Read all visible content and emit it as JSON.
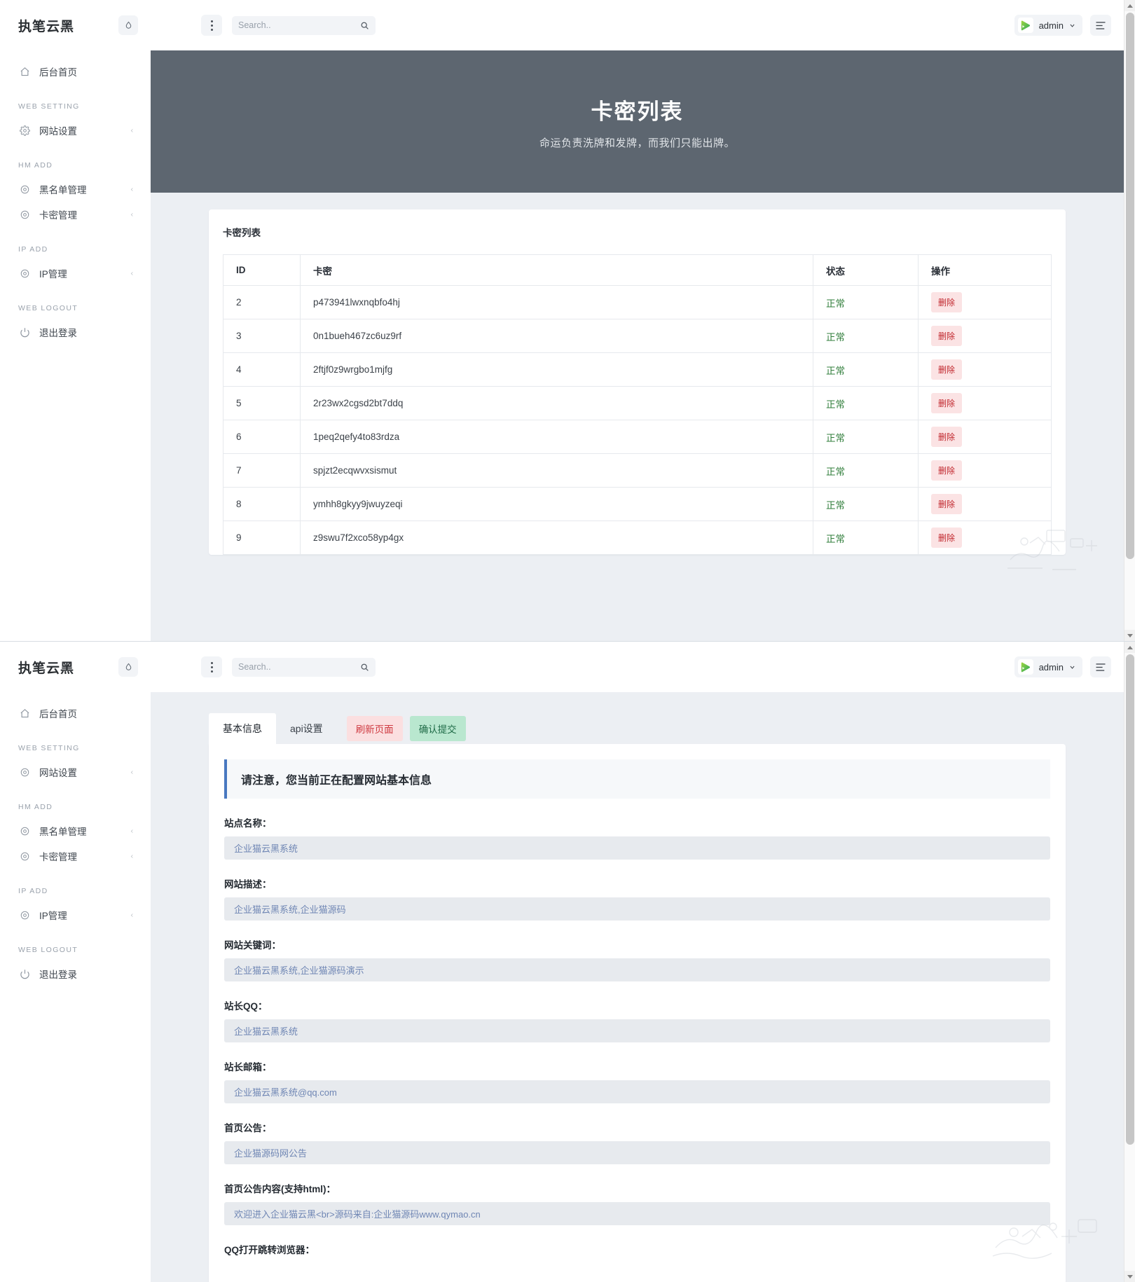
{
  "brand": {
    "name": "执笔云黑",
    "badge_icon": "droplet-icon"
  },
  "topbar": {
    "kebab_icon": "more-vertical-icon",
    "search": {
      "placeholder": "Search..",
      "value": "",
      "icon": "search-icon"
    },
    "user": {
      "name": "admin",
      "avatar_icon": "play-avatar-icon",
      "chevron_icon": "chevron-down-icon"
    },
    "menu_icon": "list-menu-icon"
  },
  "sidebar": {
    "items": [
      {
        "label": "后台首页",
        "icon": "home-icon",
        "caret": false,
        "group": null
      },
      {
        "label": "WEB SETTING",
        "type": "group"
      },
      {
        "label": "网站设置",
        "icon": "gear-icon",
        "caret": true
      },
      {
        "label": "HM ADD",
        "type": "group"
      },
      {
        "label": "黑名单管理",
        "icon": "gear-icon",
        "caret": true
      },
      {
        "label": "卡密管理",
        "icon": "gear-icon",
        "caret": true
      },
      {
        "label": "IP ADD",
        "type": "group"
      },
      {
        "label": "IP管理",
        "icon": "gear-icon",
        "caret": true
      },
      {
        "label": "WEB LOGOUT",
        "type": "group"
      },
      {
        "label": "退出登录",
        "icon": "power-icon",
        "caret": false
      }
    ]
  },
  "view_top": {
    "hero": {
      "title": "卡密列表",
      "subtitle": "命运负责洗牌和发牌，而我们只能出牌。"
    },
    "card": {
      "title": "卡密列表",
      "columns": [
        "ID",
        "卡密",
        "状态",
        "操作"
      ],
      "rows": [
        {
          "id": "2",
          "code": "p473941lwxnqbfo4hj",
          "status": "正常",
          "action": "删除"
        },
        {
          "id": "3",
          "code": "0n1bueh467zc6uz9rf",
          "status": "正常",
          "action": "删除"
        },
        {
          "id": "4",
          "code": "2ftjf0z9wrgbo1mjfg",
          "status": "正常",
          "action": "删除"
        },
        {
          "id": "5",
          "code": "2r23wx2cgsd2bt7ddq",
          "status": "正常",
          "action": "删除"
        },
        {
          "id": "6",
          "code": "1peq2qefy4to83rdza",
          "status": "正常",
          "action": "删除"
        },
        {
          "id": "7",
          "code": "spjzt2ecqwvxsismut",
          "status": "正常",
          "action": "删除"
        },
        {
          "id": "8",
          "code": "ymhh8gkyy9jwuyzeqi",
          "status": "正常",
          "action": "删除"
        },
        {
          "id": "9",
          "code": "z9swu7f2xco58yp4gx",
          "status": "正常",
          "action": "删除"
        }
      ]
    }
  },
  "view_bottom": {
    "tabs": [
      {
        "label": "基本信息",
        "active": true
      },
      {
        "label": "api设置",
        "active": false
      }
    ],
    "buttons": {
      "refresh": "刷新页面",
      "submit": "确认提交"
    },
    "alert": "请注意，您当前正在配置网站基本信息",
    "fields": [
      {
        "label": "站点名称：",
        "value": "企业猫云黑系统"
      },
      {
        "label": "网站描述：",
        "value": "企业猫云黑系统,企业猫源码"
      },
      {
        "label": "网站关键词：",
        "value": "企业猫云黑系统,企业猫源码演示"
      },
      {
        "label": "站长QQ：",
        "value": "企业猫云黑系统"
      },
      {
        "label": "站长邮箱：",
        "value": "企业猫云黑系统@qq.com"
      },
      {
        "label": "首页公告：",
        "value": "企业猫源码网公告"
      },
      {
        "label": "首页公告内容(支持html)：",
        "value": "欢迎进入企业猫云黑<br>源码来自:企业猫源码www.qymao.cn"
      },
      {
        "label": "QQ打开跳转浏览器：",
        "value": ""
      }
    ]
  },
  "colors": {
    "hero_bg": "#5d6670",
    "canvas_bg": "#eceff3",
    "accent_blue": "#4878c0",
    "status_green": "#2f7d3a",
    "delete_red": "#c1272d",
    "submit_green": "#1f6b47"
  }
}
